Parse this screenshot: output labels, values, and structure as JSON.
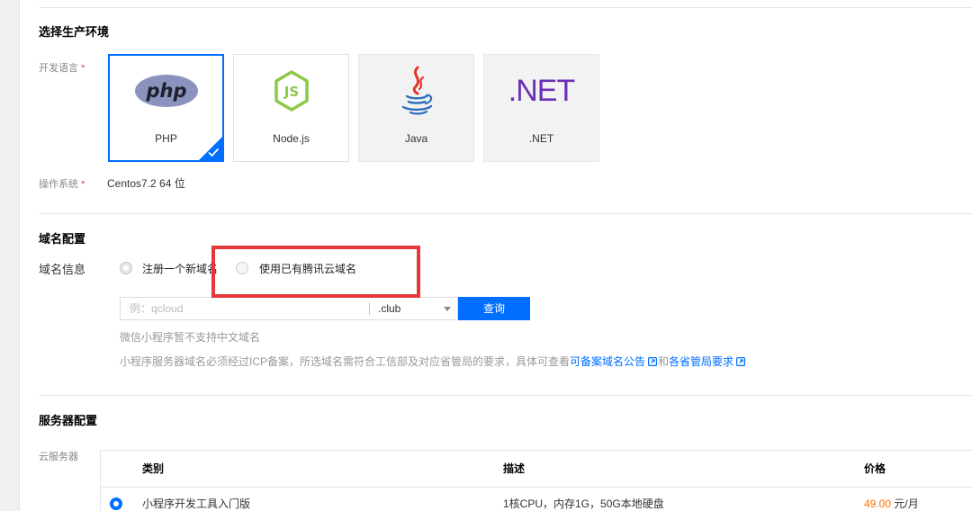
{
  "colors": {
    "accent": "#006eff",
    "required": "#e54545",
    "price": "#ff7200",
    "highlight": "#e5383b",
    "php_logo": "#8993be",
    "node_logo": "#8cc84b",
    "dotnet_logo": "#6a30b5",
    "java_steam": "#e4342a",
    "java_cup": "#2f6fbf"
  },
  "environment": {
    "title": "选择生产环境",
    "language_label": "开发语言",
    "required_mark": "*",
    "languages": [
      {
        "label": "PHP",
        "logo": "php-logo",
        "logo_text": "php",
        "selected": true,
        "disabled": false
      },
      {
        "label": "Node.js",
        "logo": "nodejs-logo",
        "logo_text": "JS",
        "selected": false,
        "disabled": false
      },
      {
        "label": "Java",
        "logo": "java-logo",
        "selected": false,
        "disabled": true
      },
      {
        "label": ".NET",
        "logo": "dotnet-logo",
        "logo_text": ".NET",
        "selected": false,
        "disabled": true
      }
    ],
    "os_label": "操作系统",
    "os_value": "Centos7.2 64 位"
  },
  "domain": {
    "title": "域名配置",
    "info_label": "域名信息",
    "options": [
      {
        "label": "注册一个新域名",
        "checked": false,
        "disabled": true
      },
      {
        "label": "使用已有腾讯云域名",
        "checked": false,
        "disabled": false
      }
    ],
    "input_placeholder": "例：qcloud",
    "suffix": ".club",
    "query_button": "查询",
    "hint_chinese": "微信小程序暂不支持中文域名",
    "hint_icp": {
      "text": "小程序服务器域名必须经过ICP备案，所选域名需符合工信部及对应省管局的要求，具体可查看",
      "link_filing": "可备案域名公告",
      "conjunction": "和",
      "link_provinces": "各省管局要求"
    }
  },
  "server": {
    "title": "服务器配置",
    "cvm_label": "云服务器",
    "columns": [
      "类别",
      "描述",
      "价格"
    ],
    "rows": [
      {
        "selected": true,
        "category": "小程序开发工具入门版",
        "description": "1核CPU，内存1G，50G本地硬盘",
        "price": "49.00",
        "unit": "元/月"
      }
    ]
  }
}
